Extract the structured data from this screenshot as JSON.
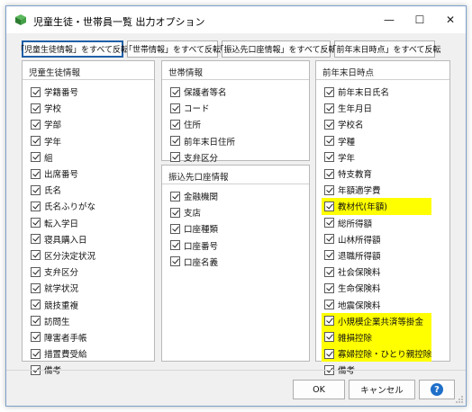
{
  "window": {
    "title": "児童生徒・世帯員一覧  出力オプション",
    "minimize": "—",
    "maximize": "☐",
    "close": "✕"
  },
  "toolbar": {
    "buttons": [
      "「児童生徒情報」をすべて反転",
      "「世帯情報」をすべて反転",
      "「振込先口座情報」をすべて反転",
      "「前年末日時点」をすべて反転"
    ]
  },
  "panels": {
    "student": {
      "title": "児童生徒情報",
      "items": [
        "学籍番号",
        "学校",
        "学部",
        "学年",
        "組",
        "出席番号",
        "氏名",
        "氏名ふりがな",
        "転入学日",
        "寝具購入日",
        "区分決定状況",
        "支弁区分",
        "就学状況",
        "競技重複",
        "訪問生",
        "障害者手帳",
        "措置費受給",
        "備考"
      ]
    },
    "household": {
      "title": "世帯情報",
      "items": [
        "保護者等名",
        "コード",
        "住所",
        "前年末日住所",
        "支弁区分"
      ]
    },
    "bank": {
      "title": "振込先口座情報",
      "items": [
        "金融機関",
        "支店",
        "口座種類",
        "口座番号",
        "口座名義"
      ]
    },
    "prior_year": {
      "title": "前年末日時点",
      "items": [
        "前年末日氏名",
        "生年月日",
        "学校名",
        "学種",
        "学年",
        "特支教育",
        "年額適学費",
        "教材代(年額)",
        "総所得額",
        "山林所得額",
        "退職所得額",
        "社会保険料",
        "生命保険料",
        "地震保険料",
        "小規模企業共済等掛金",
        "雑損控除",
        "寡婦控除・ひとり親控除",
        "備考"
      ],
      "highlighted": [
        7,
        14,
        15,
        16
      ]
    }
  },
  "buttons": {
    "ok": "OK",
    "cancel": "キャンセル",
    "help": "?"
  },
  "colors": {
    "highlight": "#ffff00",
    "active_border": "#1f5fa8",
    "help_icon": "#1e6fc9"
  }
}
